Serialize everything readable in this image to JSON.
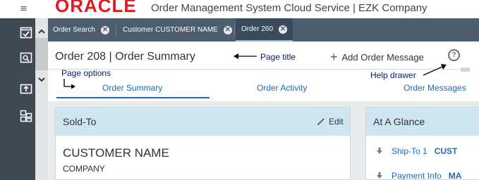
{
  "header": {
    "logo": "ORACLE",
    "app_title": "Order Management System Cloud Service | EZK Company"
  },
  "rail": {
    "icons": [
      "menu-icon",
      "checklist-icon",
      "search-doc-icon",
      "upload-icon",
      "layout-icon"
    ]
  },
  "tabs": [
    {
      "label": "Order Search",
      "active": false
    },
    {
      "label": "Customer CUSTOMER NAME",
      "active": false
    },
    {
      "label": "Order 260",
      "active": true
    }
  ],
  "page": {
    "title": "Order 208 | Order Summary",
    "add_message_label": "Add Order Message",
    "help_label": "?"
  },
  "annotations": {
    "page_title": "Page title",
    "page_options": "Page options",
    "help_drawer": "Help drawer"
  },
  "subtabs": [
    {
      "label": "Order Summary",
      "active": true
    },
    {
      "label": "Order Activity",
      "active": false
    },
    {
      "label": "Order Messages",
      "active": false
    }
  ],
  "sold_to": {
    "title": "Sold-To",
    "edit_label": "Edit",
    "customer_name": "CUSTOMER NAME",
    "company": "COMPANY"
  },
  "at_a_glance": {
    "title": "At A Glance",
    "rows": [
      {
        "label": "Ship-To 1",
        "value": "CUST"
      },
      {
        "label": "Payment Info",
        "value": "MA"
      }
    ]
  },
  "colors": {
    "oracle_red": "#e01a22",
    "tab_bar": "#4c5d6e",
    "rail": "#3e4954",
    "link_blue": "#1f69b4",
    "card_header": "#cde6f1",
    "annotation": "#0b1a6e"
  }
}
